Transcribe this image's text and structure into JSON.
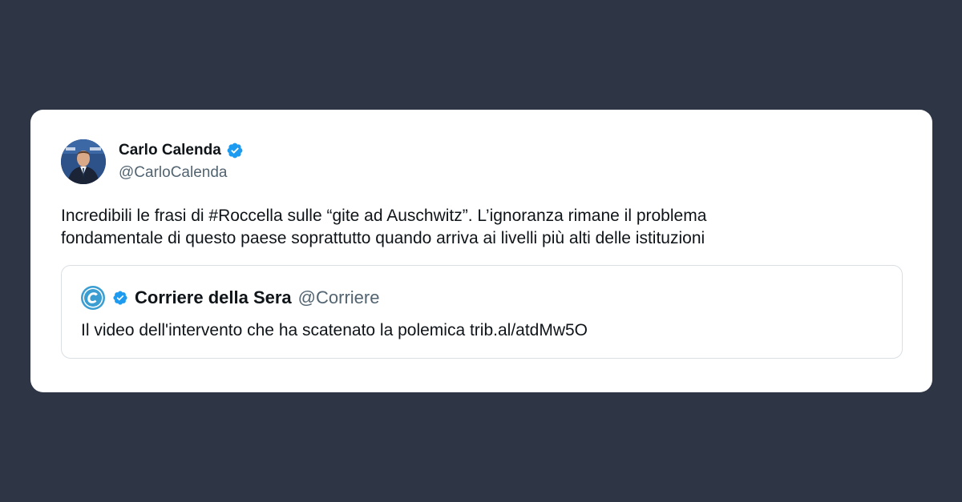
{
  "author": {
    "name": "Carlo Calenda",
    "handle": "@CarloCalenda",
    "verified": true
  },
  "tweet": {
    "lines": [
      "Incredibili le frasi di #Roccella sulle “gite ad Auschwitz”. L’ignoranza rimane il problema",
      "fondamentale di questo paese soprattutto quando arriva ai livelli più alti delle istituzioni"
    ]
  },
  "quoted": {
    "name": "Corriere della Sera",
    "handle": "@Corriere",
    "verified": true,
    "logo_icon": "corriere-c-logo",
    "text": "Il video dell'intervento che ha scatenato la polemica trib.al/atdMw5O"
  },
  "colors": {
    "background": "#2e3646",
    "card": "#ffffff",
    "verified_blue": "#1d9bf0",
    "text": "#0f1419",
    "muted": "#536471",
    "quote_border": "#dadfe3"
  }
}
